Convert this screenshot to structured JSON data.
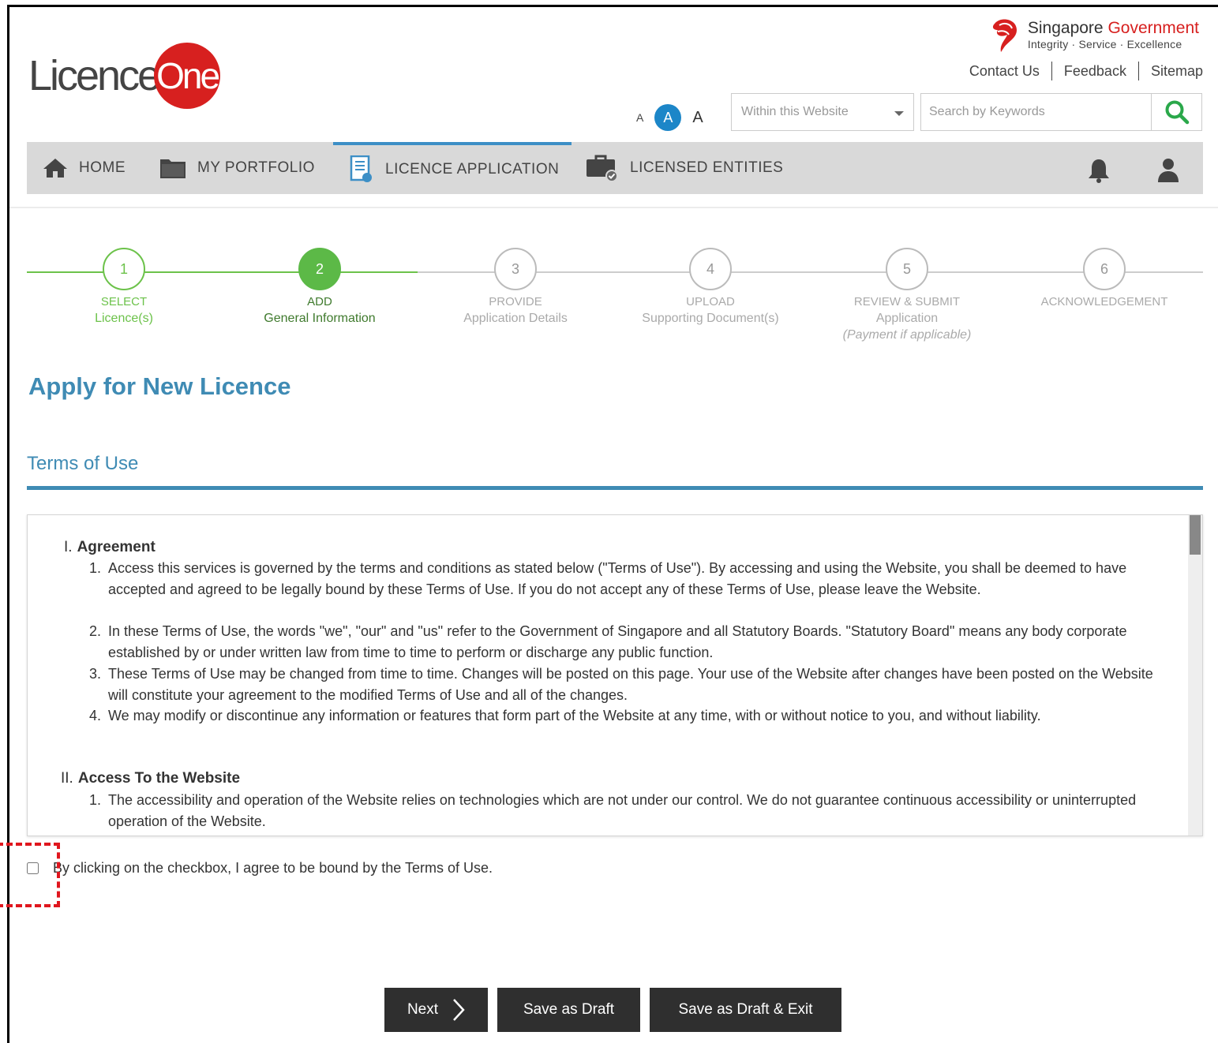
{
  "header": {
    "logo": {
      "part1": "Licence",
      "part2": "One"
    },
    "gov": {
      "title_plain": "Singapore ",
      "title_red": "Government",
      "tagline": "Integrity · Service · Excellence"
    },
    "top_links": [
      "Contact Us",
      "Feedback",
      "Sitemap"
    ],
    "font_size": {
      "small": "A",
      "medium": "A",
      "large": "A"
    },
    "search": {
      "scope": "Within this Website",
      "placeholder": "Search by Keywords"
    }
  },
  "nav": {
    "items": [
      {
        "label": "HOME",
        "icon": "home-icon"
      },
      {
        "label": "MY PORTFOLIO",
        "icon": "folder-icon"
      },
      {
        "label": "LICENCE APPLICATION",
        "icon": "document-icon",
        "active": true
      },
      {
        "label": "LICENSED ENTITIES",
        "icon": "briefcase-check-icon"
      }
    ],
    "right_icons": [
      "bell-icon",
      "user-icon"
    ]
  },
  "stepper": {
    "steps": [
      {
        "num": "1",
        "line1": "SELECT",
        "line2": "Licence(s)",
        "state": "done"
      },
      {
        "num": "2",
        "line1": "ADD",
        "line2": "General Information",
        "state": "current"
      },
      {
        "num": "3",
        "line1": "PROVIDE",
        "line2": "Application Details",
        "state": "pending"
      },
      {
        "num": "4",
        "line1": "UPLOAD",
        "line2": "Supporting Document(s)",
        "state": "pending"
      },
      {
        "num": "5",
        "line1": "REVIEW & SUBMIT",
        "line2": "Application",
        "line3": "(Payment if applicable)",
        "state": "pending"
      },
      {
        "num": "6",
        "line1": "ACKNOWLEDGEMENT",
        "state": "pending"
      }
    ]
  },
  "page": {
    "title": "Apply for New Licence",
    "section_title": "Terms of Use"
  },
  "terms": {
    "sections": [
      {
        "num": "I.",
        "heading": "Agreement",
        "items": [
          {
            "num": "1.",
            "text": "Access this services is governed by the terms and conditions as stated below (\"Terms of Use\"). By accessing and using the Website, you shall be deemed to have accepted and agreed to be legally bound by these Terms of Use. If you do not accept any of these Terms of Use, please leave the Website."
          },
          {
            "num": "2.",
            "text": "In these Terms of Use, the words \"we\", \"our\" and \"us\" refer to the Government of Singapore and all Statutory Boards. \"Statutory Board\" means any body corporate established by or under written law from time to time to perform or discharge any public function."
          },
          {
            "num": "3.",
            "text": "These Terms of Use may be changed from time to time. Changes will be posted on this page. Your use of the Website after changes have been posted on the Website will constitute your agreement to the modified Terms of Use and all of the changes."
          },
          {
            "num": "4.",
            "text": "We may modify or discontinue any information or features that form part of the Website at any time, with or without notice to you, and without liability."
          }
        ]
      },
      {
        "num": "II.",
        "heading": "Access To the Website",
        "items": [
          {
            "num": "1.",
            "text": "The accessibility and operation of the Website relies on technologies which are not under our control. We do not guarantee continuous accessibility or uninterrupted operation of the Website."
          }
        ]
      }
    ]
  },
  "agreement": {
    "label": "By clicking on the checkbox, I agree to be bound by the Terms of Use.",
    "checked": false
  },
  "buttons": {
    "next": "Next",
    "save_draft": "Save as Draft",
    "save_draft_exit": "Save as Draft & Exit"
  },
  "colors": {
    "accent_blue": "#3f8bb4",
    "brand_red": "#d7201f",
    "step_green": "#5cb947",
    "button_dark": "#2f2f2f",
    "highlight_red": "#e0161e"
  }
}
